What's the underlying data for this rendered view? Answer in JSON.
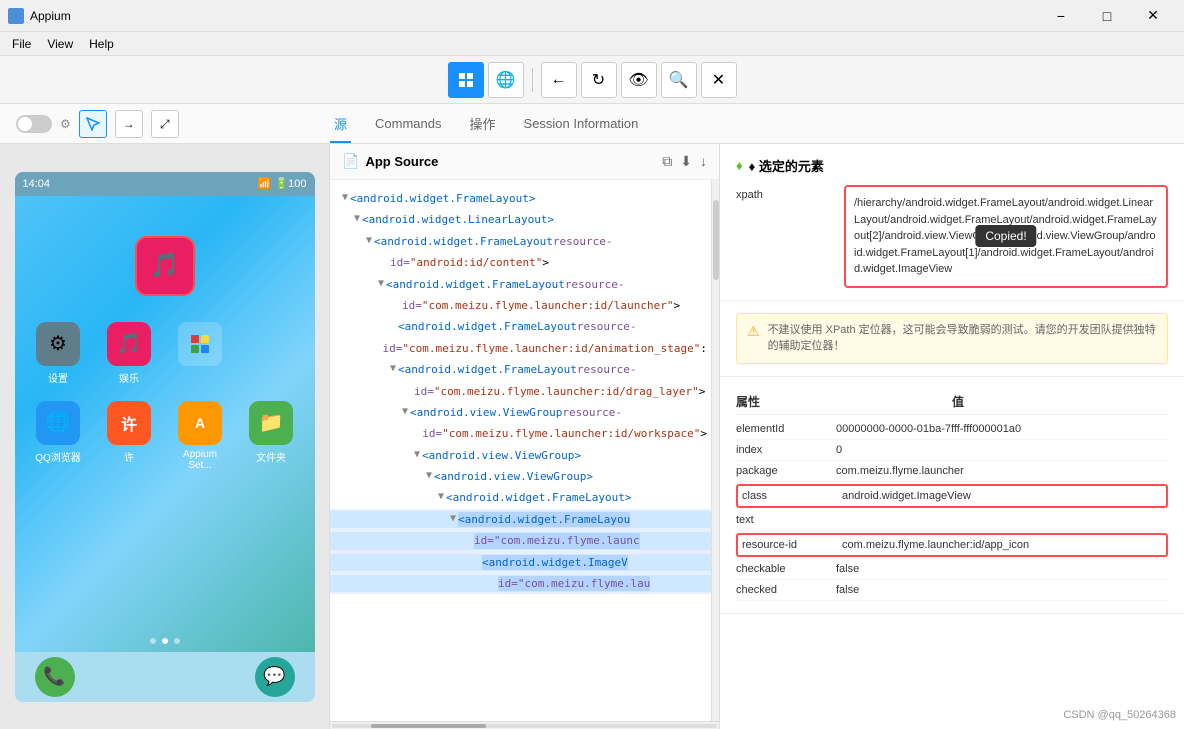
{
  "titleBar": {
    "appName": "Appium",
    "minimizeLabel": "−",
    "maximizeLabel": "□",
    "closeLabel": "✕"
  },
  "menuBar": {
    "items": [
      "File",
      "View",
      "Help"
    ]
  },
  "toolbar": {
    "icons": [
      "grid",
      "globe",
      "back",
      "refresh",
      "eye",
      "search",
      "close"
    ]
  },
  "inspectorTabs": {
    "tabs": [
      "源",
      "Commands",
      "操作",
      "Session Information"
    ],
    "activeIndex": 0
  },
  "sourcePanel": {
    "title": "App Source",
    "nodes": [
      {
        "indent": 0,
        "toggle": "▼",
        "tag": "<android.widget.FrameLayout>",
        "attr": ""
      },
      {
        "indent": 1,
        "toggle": "▼",
        "tag": "<android.widget.LinearLayout>",
        "attr": ""
      },
      {
        "indent": 2,
        "toggle": "▼",
        "tag": "<android.widget.FrameLayout ",
        "attrName": "resource-",
        "attrVal": "",
        "suffix": ""
      },
      {
        "indent": 3,
        "content": "id=\"android:id/content\">"
      },
      {
        "indent": 3,
        "toggle": "▼",
        "tag": "<android.widget.FrameLayout ",
        "attrName": "resource-"
      },
      {
        "indent": 4,
        "content": "id=\"com.meizu.flyme.launcher:id/launcher\">"
      },
      {
        "indent": 4,
        "tag": "<android.widget.FrameLayout ",
        "attrName": "resource-"
      },
      {
        "indent": 5,
        "content": "id=\"com.meizu.flyme.launcher:id/animation_stage\">"
      },
      {
        "indent": 4,
        "toggle": "▼",
        "tag": "<android.widget.FrameLayout ",
        "attrName": "resource-"
      },
      {
        "indent": 5,
        "content": "id=\"com.meizu.flyme.launcher:id/drag_layer\">"
      },
      {
        "indent": 5,
        "toggle": "▼",
        "tag": "<android.view.ViewGroup ",
        "attrName": "resource-"
      },
      {
        "indent": 6,
        "content": "id=\"com.meizu.flyme.launcher:id/workspace\">"
      },
      {
        "indent": 6,
        "toggle": "▼",
        "tag": "<android.view.ViewGroup>"
      },
      {
        "indent": 7,
        "toggle": "▼",
        "tag": "<android.view.ViewGroup>"
      },
      {
        "indent": 8,
        "toggle": "▼",
        "tag": "<android.widget.FrameLayout>"
      },
      {
        "indent": 9,
        "toggle": "▼",
        "tag": "<android.widget.FrameLayou",
        "highlighted": true
      },
      {
        "indent": 10,
        "content": "id=\"com.meizu.flyme.launc",
        "highlighted": true
      },
      {
        "indent": 10,
        "tag": "<android.widget.ImageV",
        "highlighted": true
      },
      {
        "indent": 11,
        "content": "id=\"com.meizu.flyme.lau",
        "highlighted": true
      }
    ]
  },
  "detailsPanel": {
    "sectionTitle": "♦ 选定的元素",
    "xpath": {
      "label": "xpath",
      "value": "/hierarchy/android.widget.FrameLayout/android.widget.LinearLayout/android.widget.FrameLayout/android.widget.FrameLayout[2]/android.view.ViewGroup/android.view.ViewGroup/android.widget.FrameLayout[1]/android.widget.FrameLayout/android.widget.ImageView",
      "copiedText": "Copied!"
    },
    "warning": "不建议使用 XPath 定位器，这可能会导致脆弱的测试。请您的开发团队提供独特的辅助定位器！",
    "attrsHeader": {
      "col1": "属性",
      "col2": "值"
    },
    "attrs": [
      {
        "name": "elementId",
        "value": "00000000-0000-01ba-7fff-fff000001a0",
        "highlighted": false
      },
      {
        "name": "index",
        "value": "0",
        "highlighted": false
      },
      {
        "name": "package",
        "value": "com.meizu.flyme.launcher",
        "highlighted": false
      },
      {
        "name": "class",
        "value": "android.widget.ImageView",
        "highlighted": true
      },
      {
        "name": "text",
        "value": "",
        "highlighted": false
      },
      {
        "name": "resource-id",
        "value": "com.meizu.flyme.launcher:id/app_icon",
        "highlighted": true
      },
      {
        "name": "checkable",
        "value": "false",
        "highlighted": false
      },
      {
        "name": "checked",
        "value": "false",
        "highlighted": false
      }
    ]
  },
  "phone": {
    "statusTime": "14:04",
    "battery": "100",
    "apps": [
      {
        "label": "设置",
        "bg": "#607d8b",
        "icon": "⚙"
      },
      {
        "label": "娱乐",
        "bg": "#e91e63",
        "icon": "🎵"
      },
      {
        "label": "",
        "bg": "#9c27b0",
        "icon": ""
      },
      {
        "label": "",
        "bg": "transparent",
        "icon": ""
      },
      {
        "label": "QQ浏览器",
        "bg": "#2196f3",
        "icon": "🌐"
      },
      {
        "label": "许",
        "bg": "#ff5722",
        "icon": "许"
      },
      {
        "label": "Appium Set...",
        "bg": "#ff9800",
        "icon": "A"
      },
      {
        "label": "文件夹",
        "bg": "#4caf50",
        "icon": "📁"
      }
    ],
    "dockApps": [
      {
        "bg": "#4caf50",
        "icon": "📞"
      },
      {
        "bg": "#26a69a",
        "icon": ""
      },
      {
        "bg": "#1565c0",
        "icon": "💬"
      }
    ]
  },
  "watermark": "CSDN @qq_50264368"
}
